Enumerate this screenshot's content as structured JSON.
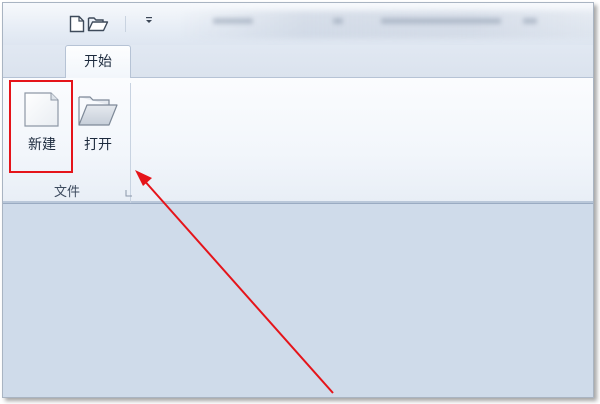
{
  "ribbon": {
    "tabs": [
      {
        "label": "开始",
        "active": true
      }
    ],
    "groups": [
      {
        "label": "文件",
        "buttons": [
          {
            "label": "新建",
            "icon": "new-document-icon",
            "highlighted": true
          },
          {
            "label": "打开",
            "icon": "open-folder-icon"
          }
        ]
      }
    ]
  },
  "quick_access": {
    "items": [
      {
        "icon": "new-document-icon"
      },
      {
        "icon": "open-folder-icon"
      },
      {
        "icon": "customize-toolbar-dropdown-icon"
      }
    ]
  },
  "annotation": {
    "highlight_color": "#e5141a",
    "arrow_color": "#e5141a",
    "points_to": "新建"
  },
  "colors": {
    "ribbon_bg": "#f2f6fb",
    "workspace_bg": "#cfdbea",
    "tab_border": "#b6c3d5"
  }
}
